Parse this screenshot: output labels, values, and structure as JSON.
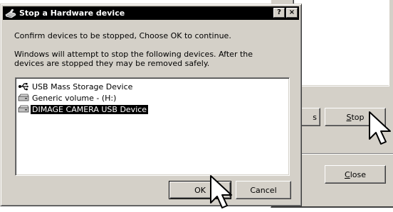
{
  "background_window": {
    "properties_button": "s",
    "stop_button_label": "Stop",
    "stop_button_mnemonic": "S",
    "stop_button_rest": "top",
    "close_button_label": "Close",
    "close_button_mnemonic": "C",
    "close_button_rest": "lose"
  },
  "dialog": {
    "title": "Stop a Hardware device",
    "help_button": "?",
    "close_button": "×",
    "confirm_text": "Confirm devices to be stopped, Choose OK to continue.",
    "info_text": "Windows will attempt to stop the following devices. After the devices are stopped they may be removed safely.",
    "devices": [
      {
        "label": "USB Mass Storage Device",
        "icon": "usb-icon",
        "selected": false
      },
      {
        "label": "Generic volume - (H:)",
        "icon": "drive-icon",
        "selected": false
      },
      {
        "label": "DIMAGE CAMERA USB Device",
        "icon": "drive-icon",
        "selected": true
      }
    ],
    "ok_button": "OK",
    "cancel_button": "Cancel"
  },
  "cursors": [
    "arrow-cursor-icon",
    "arrow-cursor-icon"
  ]
}
